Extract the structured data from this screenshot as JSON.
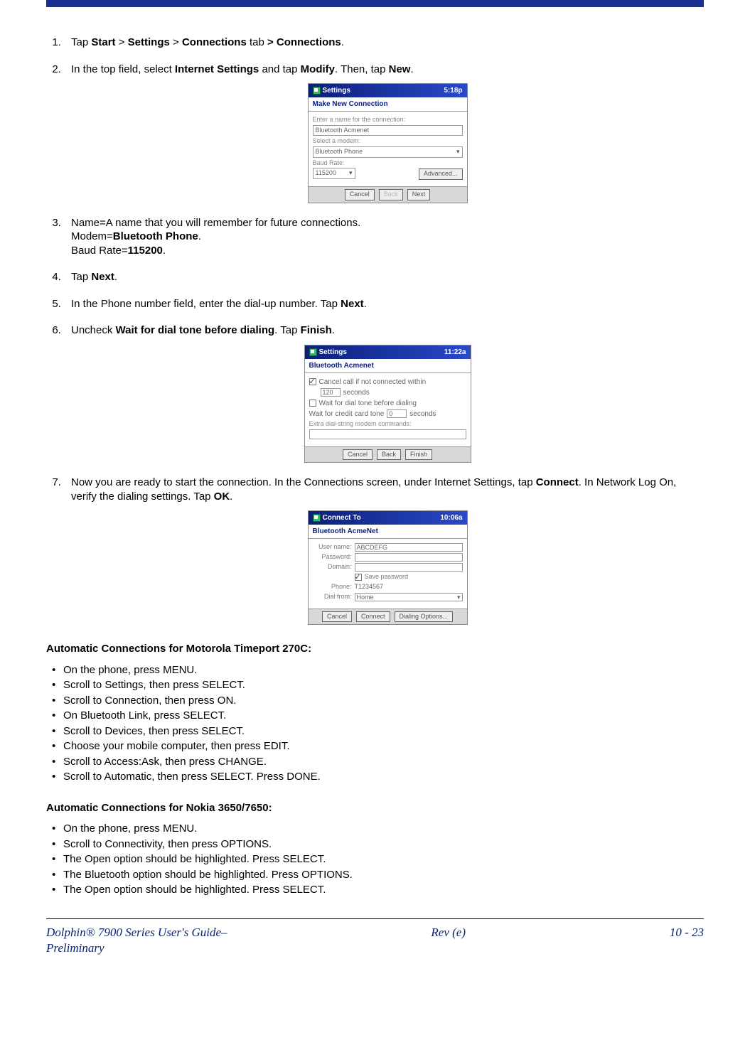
{
  "steps": {
    "s1": {
      "pre": "Tap ",
      "b1": "Start",
      "sep1": " > ",
      "b2": "Settings",
      "sep2": " > ",
      "b3": "Connections",
      "tab": " tab ",
      "sep3": "> ",
      "b4": "Connections",
      "end": "."
    },
    "s2": {
      "pre1": "In the top field, select ",
      "b1": "Internet Settings",
      "mid": " and tap ",
      "b2": "Modify",
      "then": ". Then, tap ",
      "b3": "New",
      "end": "."
    },
    "s3": {
      "line1": "Name=A name that you will remember for future connections.",
      "line2a": "Modem=",
      "line2b": "Bluetooth Phone",
      "line2c": ".",
      "line3a": "Baud Rate=",
      "line3b": "115200",
      "line3c": "."
    },
    "s4": {
      "pre": "Tap ",
      "b": "Next",
      "end": "."
    },
    "s5": {
      "pre": "In the Phone number field, enter the dial-up number. Tap ",
      "b": "Next",
      "end": "."
    },
    "s6": {
      "pre": "Uncheck ",
      "b1": "Wait for dial tone before dialing",
      "mid": ". Tap ",
      "b2": "Finish",
      "end": "."
    },
    "s7": {
      "pre": "Now you are ready to start the connection. In the Connections screen, under Internet Settings, tap ",
      "b1": "Connect",
      "mid": ". In Network Log On, verify the dialing settings. Tap ",
      "b2": "OK",
      "end": "."
    }
  },
  "mock1": {
    "title": "Settings",
    "time": "5:18p",
    "subtitle": "Make New Connection",
    "lbl_name": "Enter a name for the connection:",
    "val_name": "Bluetooth Acmenet",
    "lbl_modem": "Select a modem:",
    "val_modem": "Bluetooth Phone",
    "lbl_baud": "Baud Rate:",
    "val_baud": "115200",
    "btn_adv": "Advanced...",
    "btn_cancel": "Cancel",
    "btn_back": "Back",
    "btn_next": "Next"
  },
  "mock2": {
    "title": "Settings",
    "time": "11:22a",
    "subtitle": "Bluetooth Acmenet",
    "chk1": "Cancel call if not connected within",
    "chk1_val": "120",
    "chk1_unit": "seconds",
    "chk2": "Wait for dial tone before dialing",
    "wait_lbl": "Wait for credit card tone",
    "wait_val": "0",
    "wait_unit": "seconds",
    "extra": "Extra dial-string modem commands:",
    "btn_cancel": "Cancel",
    "btn_back": "Back",
    "btn_finish": "Finish"
  },
  "mock3": {
    "title": "Connect To",
    "time": "10:06a",
    "subtitle": "Bluetooth AcmeNet",
    "user_lbl": "User name:",
    "user_val": "ABCDEFG",
    "pass_lbl": "Password:",
    "pass_val": "",
    "domain_lbl": "Domain:",
    "save_pwd": "Save password",
    "phone_lbl": "Phone:",
    "phone_val": "T1234567",
    "dial_lbl": "Dial from:",
    "dial_val": "Home",
    "btn_cancel": "Cancel",
    "btn_connect": "Connect",
    "btn_dialopt": "Dialing Options..."
  },
  "sections": {
    "moto_head": "Automatic Connections for Motorola Timeport 270C:",
    "moto": [
      "On the phone, press MENU.",
      "Scroll to Settings, then press SELECT.",
      "Scroll to Connection, then press ON.",
      "On Bluetooth Link, press SELECT.",
      "Scroll to Devices, then press SELECT.",
      "Choose your mobile computer, then press EDIT.",
      "Scroll to Access:Ask, then press CHANGE.",
      "Scroll to Automatic, then press SELECT. Press DONE."
    ],
    "nokia_head": "Automatic Connections for Nokia 3650/7650:",
    "nokia": [
      "On the phone, press MENU.",
      "Scroll to Connectivity, then press OPTIONS.",
      "The Open option should be highlighted. Press SELECT.",
      "The Bluetooth option should be highlighted. Press OPTIONS.",
      "The Open option should be highlighted. Press SELECT."
    ]
  },
  "footer": {
    "left1": "Dolphin® 7900 Series User's Guide–",
    "left2": "Preliminary",
    "center": "Rev (e)",
    "right": "10 - 23"
  }
}
